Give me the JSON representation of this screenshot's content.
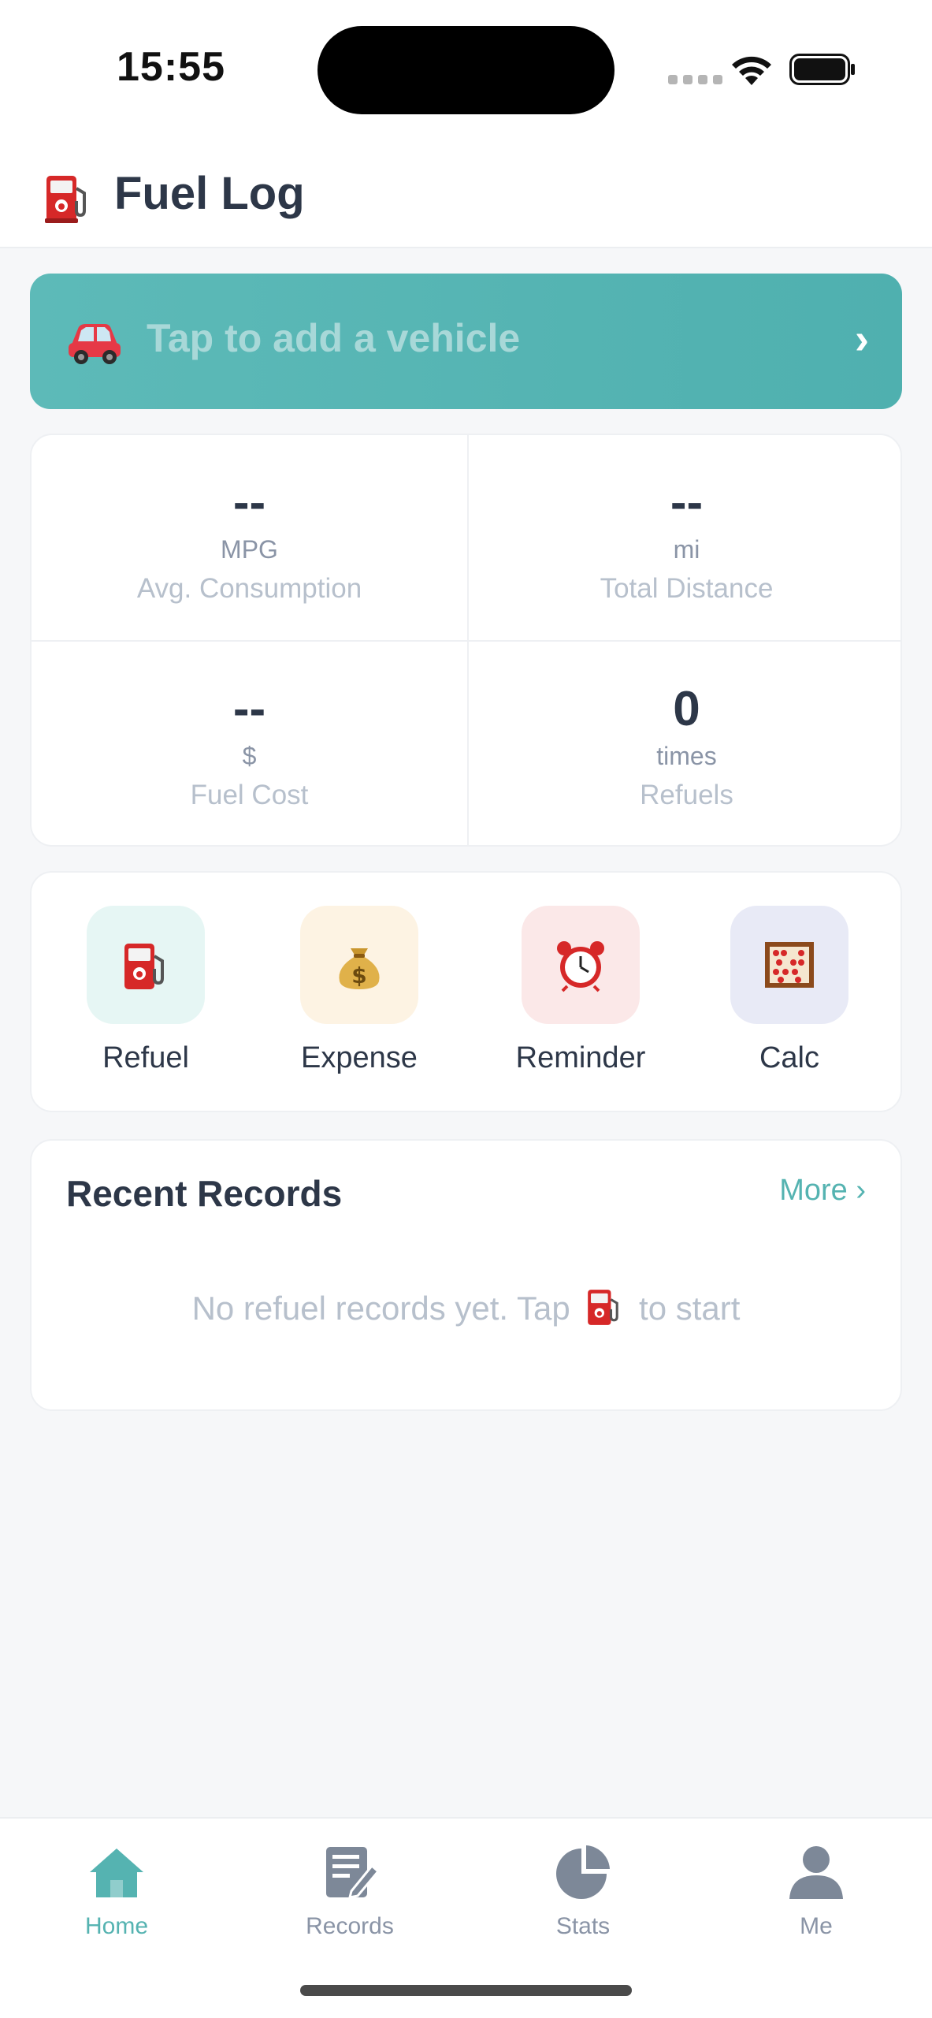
{
  "status_bar": {
    "time": "15:55"
  },
  "header": {
    "title": "Fuel Log",
    "icon": "fuel-pump-icon"
  },
  "vehicle_banner": {
    "text": "Tap to add a vehicle",
    "icon": "car-icon",
    "chevron": "›"
  },
  "stats": [
    {
      "value": "--",
      "unit": "MPG",
      "label": "Avg. Consumption"
    },
    {
      "value": "--",
      "unit": "mi",
      "label": "Total Distance"
    },
    {
      "value": "--",
      "unit": "$",
      "label": "Fuel Cost"
    },
    {
      "value": "0",
      "unit": "times",
      "label": "Refuels"
    }
  ],
  "actions": [
    {
      "label": "Refuel",
      "icon": "fuel-pump-icon",
      "tile_color": "#e6f6f4"
    },
    {
      "label": "Expense",
      "icon": "money-bag-icon",
      "tile_color": "#fdf3e3"
    },
    {
      "label": "Reminder",
      "icon": "alarm-clock-icon",
      "tile_color": "#fbe8e8"
    },
    {
      "label": "Calc",
      "icon": "abacus-icon",
      "tile_color": "#e8eaf6"
    }
  ],
  "recent_records": {
    "title": "Recent Records",
    "more": "More ›",
    "empty_before": "No refuel records yet. Tap",
    "empty_after": "to start"
  },
  "tabs": [
    {
      "label": "Home",
      "icon": "home-icon",
      "active": true
    },
    {
      "label": "Records",
      "icon": "records-icon",
      "active": false
    },
    {
      "label": "Stats",
      "icon": "pie-chart-icon",
      "active": false
    },
    {
      "label": "Me",
      "icon": "person-icon",
      "active": false
    }
  ],
  "colors": {
    "accent": "#55b3b1",
    "banner": "#52b2b1",
    "text": "#2d3748",
    "muted": "#b7c0cc"
  }
}
